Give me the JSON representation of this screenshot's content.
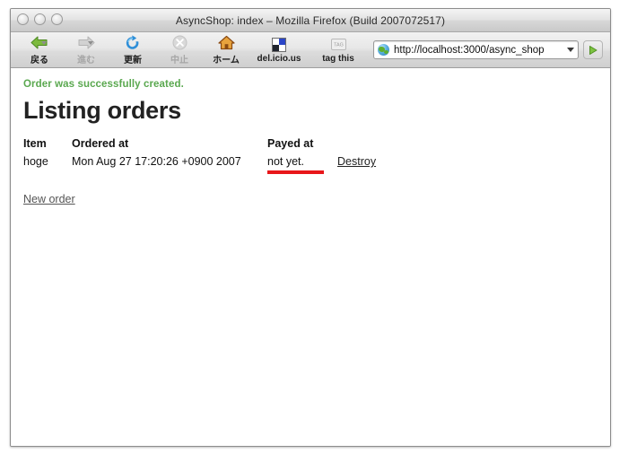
{
  "window": {
    "title": "AsyncShop: index – Mozilla Firefox (Build 2007072517)",
    "traffic_lights": [
      "close-button",
      "minimize-button",
      "zoom-button"
    ]
  },
  "toolbar": {
    "buttons": [
      {
        "label": "戻る",
        "icon": "back-arrow-icon",
        "state": "enabled",
        "has_dropdown": true
      },
      {
        "label": "進む",
        "icon": "forward-arrow-icon",
        "state": "disabled",
        "has_dropdown": true
      },
      {
        "label": "更新",
        "icon": "reload-icon",
        "state": "enabled",
        "has_dropdown": false
      },
      {
        "label": "中止",
        "icon": "stop-icon",
        "state": "disabled",
        "has_dropdown": false
      },
      {
        "label": "ホーム",
        "icon": "home-icon",
        "state": "enabled",
        "has_dropdown": false
      },
      {
        "label": "del.icio.us",
        "icon": "delicious-icon",
        "state": "enabled",
        "has_dropdown": false
      },
      {
        "label": "tag this",
        "icon": "tag-icon",
        "state": "enabled",
        "has_dropdown": false
      }
    ],
    "address_bar": {
      "favicon": "globe-favicon",
      "url": "http://localhost:3000/async_shop",
      "dropdown_icon": "chevron-down-icon",
      "go_icon": "go-arrow-icon"
    }
  },
  "page": {
    "flash_notice": "Order was successfully created.",
    "heading": "Listing orders",
    "table": {
      "headers": [
        "Item",
        "Ordered at",
        "Payed at",
        ""
      ],
      "rows": [
        {
          "item": "hoge",
          "ordered_at": "Mon Aug 27 17:20:26 +0900 2007",
          "payed_at": "not yet.",
          "action_label": "Destroy"
        }
      ]
    },
    "new_order_link": "New order",
    "annotation": {
      "type": "red-underline",
      "target": "not yet.",
      "color": "#e8161a"
    }
  },
  "colors": {
    "flash_green": "#5aa84f",
    "annotation_red": "#e8161a",
    "heading_dark": "#222222"
  }
}
